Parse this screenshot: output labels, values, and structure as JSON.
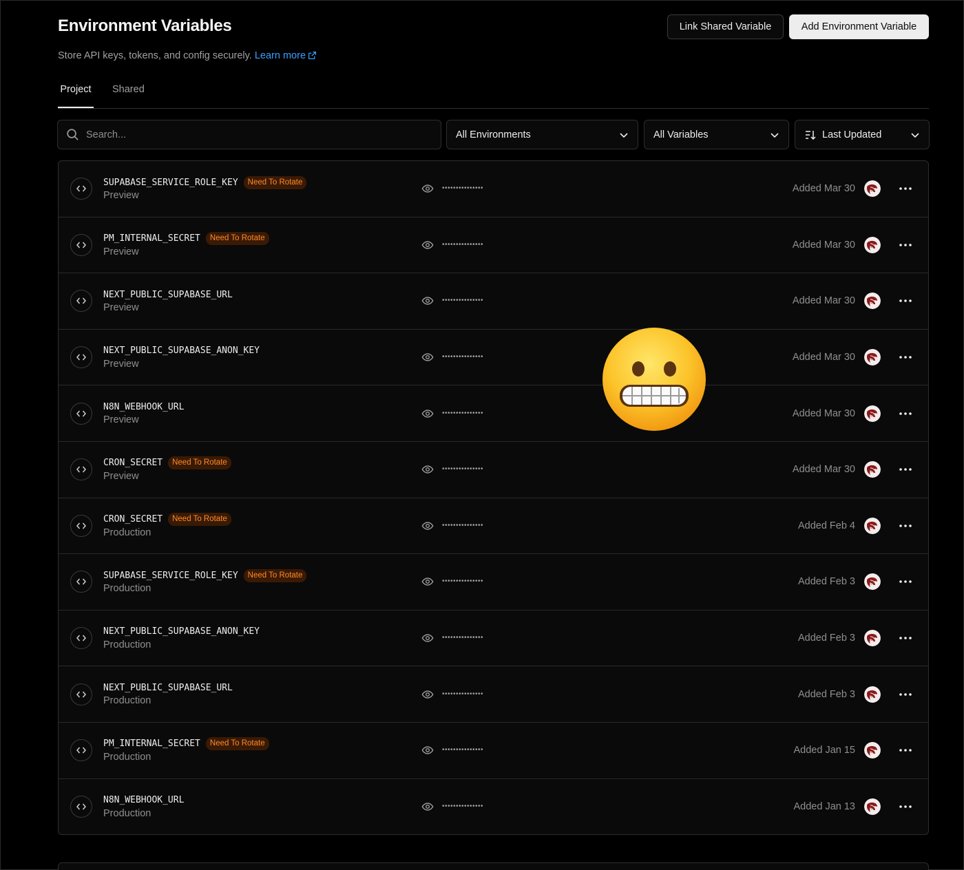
{
  "header": {
    "title": "Environment Variables",
    "subtitle": "Store API keys, tokens, and config securely.",
    "learn_more": "Learn more",
    "link_shared_label": "Link Shared Variable",
    "add_label": "Add Environment Variable"
  },
  "tabs": [
    {
      "label": "Project",
      "active": true
    },
    {
      "label": "Shared",
      "active": false
    }
  ],
  "filters": {
    "search_placeholder": "Search...",
    "environment": "All Environments",
    "variables": "All Variables",
    "sort": "Last Updated"
  },
  "colors": {
    "badge_text": "#ff8a2a",
    "link": "#3b9eff",
    "background": "#000000"
  },
  "rows": [
    {
      "name": "SUPABASE_SERVICE_ROLE_KEY",
      "badge": "Need To Rotate",
      "env": "Preview",
      "masked": "•••••••••••••••",
      "added": "Added Mar 30"
    },
    {
      "name": "PM_INTERNAL_SECRET",
      "badge": "Need To Rotate",
      "env": "Preview",
      "masked": "•••••••••••••••",
      "added": "Added Mar 30"
    },
    {
      "name": "NEXT_PUBLIC_SUPABASE_URL",
      "badge": "",
      "env": "Preview",
      "masked": "•••••••••••••••",
      "added": "Added Mar 30"
    },
    {
      "name": "NEXT_PUBLIC_SUPABASE_ANON_KEY",
      "badge": "",
      "env": "Preview",
      "masked": "•••••••••••••••",
      "added": "Added Mar 30"
    },
    {
      "name": "N8N_WEBHOOK_URL",
      "badge": "",
      "env": "Preview",
      "masked": "•••••••••••••••",
      "added": "Added Mar 30"
    },
    {
      "name": "CRON_SECRET",
      "badge": "Need To Rotate",
      "env": "Preview",
      "masked": "•••••••••••••••",
      "added": "Added Mar 30"
    },
    {
      "name": "CRON_SECRET",
      "badge": "Need To Rotate",
      "env": "Production",
      "masked": "•••••••••••••••",
      "added": "Added Feb 4"
    },
    {
      "name": "SUPABASE_SERVICE_ROLE_KEY",
      "badge": "Need To Rotate",
      "env": "Production",
      "masked": "•••••••••••••••",
      "added": "Added Feb 3"
    },
    {
      "name": "NEXT_PUBLIC_SUPABASE_ANON_KEY",
      "badge": "",
      "env": "Production",
      "masked": "•••••••••••••••",
      "added": "Added Feb 3"
    },
    {
      "name": "NEXT_PUBLIC_SUPABASE_URL",
      "badge": "",
      "env": "Production",
      "masked": "•••••••••••••••",
      "added": "Added Feb 3"
    },
    {
      "name": "PM_INTERNAL_SECRET",
      "badge": "Need To Rotate",
      "env": "Production",
      "masked": "•••••••••••••••",
      "added": "Added Jan 15"
    },
    {
      "name": "N8N_WEBHOOK_URL",
      "badge": "",
      "env": "Production",
      "masked": "•••••••••••••••",
      "added": "Added Jan 13"
    }
  ],
  "icons": {
    "row_type": "code-brackets-icon",
    "reveal": "eye-icon",
    "menu": "more-horizontal-icon",
    "overlay": "grimacing-face-emoji"
  }
}
